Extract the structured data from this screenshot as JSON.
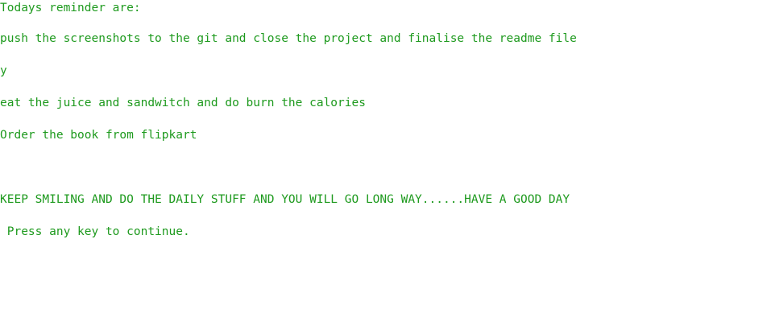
{
  "console": {
    "text_color": "#1e9a1e",
    "background": "#ffffff",
    "heading": "Todays reminder are:",
    "reminders": [
      "push the screenshots to the git and close the project and finalise the readme file",
      "y",
      "eat the juice and sandwitch and do burn the calories",
      "Order the book from flipkart"
    ],
    "motto": "KEEP SMILING AND DO THE DAILY STUFF AND YOU WILL GO LONG WAY......HAVE A GOOD DAY",
    "prompt": " Press any key to continue."
  }
}
